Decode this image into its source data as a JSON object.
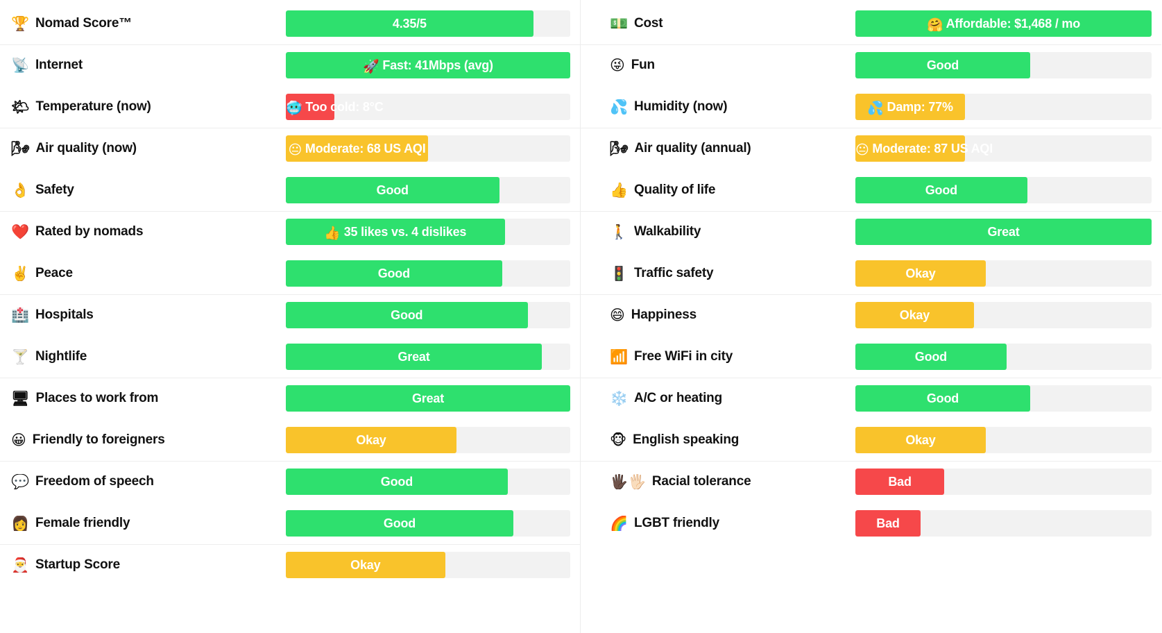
{
  "colors": {
    "great": "#2ee06e",
    "good": "#2ee06e",
    "okay": "#f9c32b",
    "bad": "#f6484a",
    "track": "#f2f2f2",
    "text_on_bar": "#ffffff",
    "label_text": "#111111"
  },
  "left_column": [
    {
      "icon": "trophy-icon",
      "emoji": "🏆",
      "label": "Nomad Score™",
      "value": "4.35/5",
      "value_emoji": "",
      "rating": "great",
      "fill_pct": 87
    },
    {
      "icon": "satellite-icon",
      "emoji": "📡",
      "label": "Internet",
      "value": "Fast: 41Mbps (avg)",
      "value_emoji": "🚀",
      "rating": "great",
      "fill_pct": 100
    },
    {
      "icon": "sun-cloud-icon",
      "emoji": "🌤",
      "label": "Temperature (now)",
      "value": "Too cold: 8°C",
      "value_emoji": "🥶",
      "rating": "bad",
      "fill_pct": 17
    },
    {
      "icon": "globe-icon",
      "emoji": "🌬",
      "label": "Air quality (now)",
      "value": "Moderate: 68 US AQI",
      "value_emoji": "😐",
      "rating": "okay",
      "fill_pct": 50
    },
    {
      "icon": "ok-hand-icon",
      "emoji": "👌",
      "label": "Safety",
      "value": "Good",
      "value_emoji": "",
      "rating": "good",
      "fill_pct": 75
    },
    {
      "icon": "red-heart-icon",
      "emoji": "❤️",
      "label": "Rated by nomads",
      "value": "35 likes vs.  4 dislikes",
      "value_emoji": "👍",
      "rating": "good",
      "fill_pct": 77
    },
    {
      "icon": "victory-hand-icon",
      "emoji": "✌️",
      "label": "Peace",
      "value": "Good",
      "value_emoji": "",
      "rating": "good",
      "fill_pct": 76
    },
    {
      "icon": "hospital-icon",
      "emoji": "🏥",
      "label": "Hospitals",
      "value": "Good",
      "value_emoji": "",
      "rating": "good",
      "fill_pct": 85
    },
    {
      "icon": "cocktail-icon",
      "emoji": "🍸",
      "label": "Nightlife",
      "value": "Great",
      "value_emoji": "",
      "rating": "great",
      "fill_pct": 90
    },
    {
      "icon": "desktop-icon",
      "emoji": "🖥",
      "label": "Places to work from",
      "value": "Great",
      "value_emoji": "",
      "rating": "great",
      "fill_pct": 100
    },
    {
      "icon": "grin-icon",
      "emoji": "😀",
      "label": "Friendly to foreigners",
      "value": "Okay",
      "value_emoji": "",
      "rating": "okay",
      "fill_pct": 60
    },
    {
      "icon": "speech-burst-icon",
      "emoji": "💬",
      "label": "Freedom of speech",
      "value": "Good",
      "value_emoji": "",
      "rating": "good",
      "fill_pct": 78
    },
    {
      "icon": "woman-icon",
      "emoji": "👩",
      "label": "Female friendly",
      "value": "Good",
      "value_emoji": "",
      "rating": "good",
      "fill_pct": 80
    },
    {
      "icon": "santa-icon",
      "emoji": "🎅",
      "label": "Startup Score",
      "value": "Okay",
      "value_emoji": "",
      "rating": "okay",
      "fill_pct": 56
    }
  ],
  "right_column": [
    {
      "icon": "money-icon",
      "emoji": "💵",
      "label": "Cost",
      "value": "Affordable: $1,468 / mo",
      "value_emoji": "🤗",
      "rating": "great",
      "fill_pct": 100
    },
    {
      "icon": "tongue-face-icon",
      "emoji": "😜",
      "label": "Fun",
      "value": "Good",
      "value_emoji": "",
      "rating": "good",
      "fill_pct": 59
    },
    {
      "icon": "sweat-droplets-icon",
      "emoji": "💦",
      "label": "Humidity (now)",
      "value": "Damp: 77%",
      "value_emoji": "💦",
      "rating": "okay",
      "fill_pct": 37
    },
    {
      "icon": "globe-icon",
      "emoji": "🌬",
      "label": "Air quality (annual)",
      "value": "Moderate: 87 US AQI",
      "value_emoji": "😐",
      "rating": "okay",
      "fill_pct": 37
    },
    {
      "icon": "thumbs-up-icon",
      "emoji": "👍",
      "label": "Quality of life",
      "value": "Good",
      "value_emoji": "",
      "rating": "good",
      "fill_pct": 58
    },
    {
      "icon": "walking-icon",
      "emoji": "🚶",
      "label": "Walkability",
      "value": "Great",
      "value_emoji": "",
      "rating": "great",
      "fill_pct": 100
    },
    {
      "icon": "traffic-light-icon",
      "emoji": "🚦",
      "label": "Traffic safety",
      "value": "Okay",
      "value_emoji": "",
      "rating": "okay",
      "fill_pct": 44
    },
    {
      "icon": "grin-icon",
      "emoji": "😄",
      "label": "Happiness",
      "value": "Okay",
      "value_emoji": "",
      "rating": "okay",
      "fill_pct": 40
    },
    {
      "icon": "bar-chart-icon",
      "emoji": "📶",
      "label": "Free WiFi in city",
      "value": "Good",
      "value_emoji": "",
      "rating": "good",
      "fill_pct": 51
    },
    {
      "icon": "snowflake-icon",
      "emoji": "❄️",
      "label": "A/C or heating",
      "value": "Good",
      "value_emoji": "",
      "rating": "good",
      "fill_pct": 59
    },
    {
      "icon": "monkey-icon",
      "emoji": "🐵",
      "label": "English speaking",
      "value": "Okay",
      "value_emoji": "",
      "rating": "okay",
      "fill_pct": 44
    },
    {
      "icon": "two-hands-icon",
      "emoji": "🖐🏿🖐🏻",
      "label": "Racial tolerance",
      "value": "Bad",
      "value_emoji": "",
      "rating": "bad",
      "fill_pct": 30
    },
    {
      "icon": "rainbow-icon",
      "emoji": "🌈",
      "label": "LGBT friendly",
      "value": "Bad",
      "value_emoji": "",
      "rating": "bad",
      "fill_pct": 22
    }
  ]
}
